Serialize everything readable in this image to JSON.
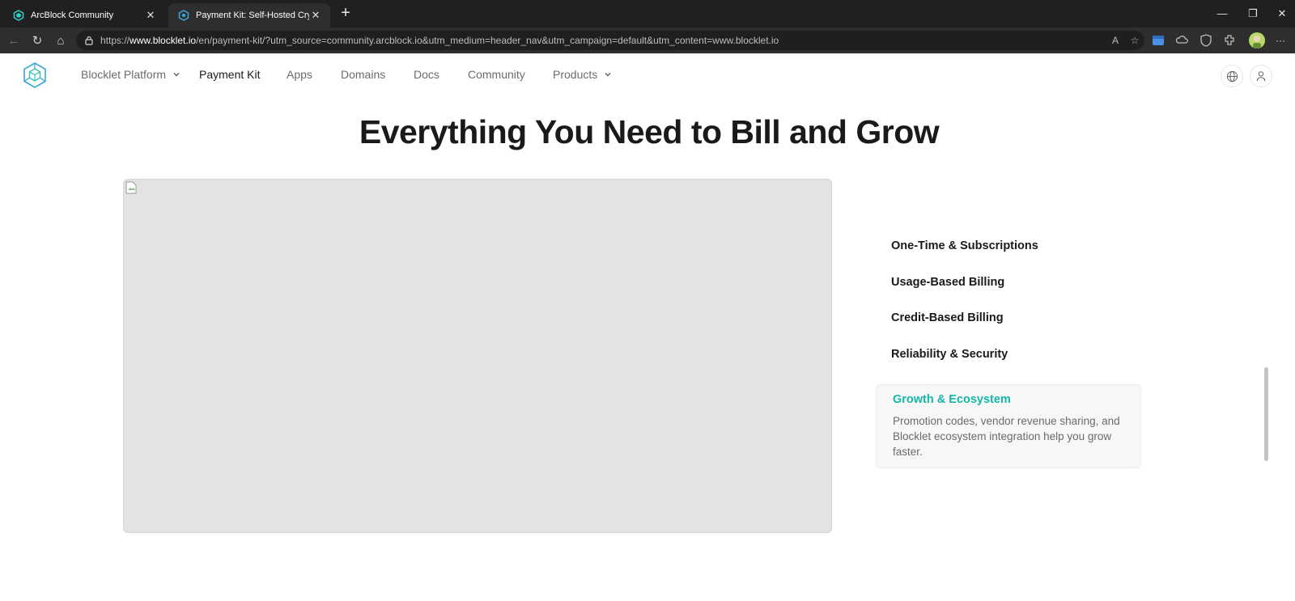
{
  "browser": {
    "tabs": [
      {
        "title": "ArcBlock Community",
        "active": false
      },
      {
        "title": "Payment Kit: Self-Hosted Crypto &",
        "active": true
      }
    ],
    "url": {
      "prefix": "https://",
      "host": "www.blocklet.io",
      "path": "/en/payment-kit/?utm_source=community.arcblock.io&utm_medium=header_nav&utm_campaign=default&utm_content=www.blocklet.io"
    },
    "icons": [
      "back-icon",
      "refresh-icon",
      "home-icon",
      "lock-icon",
      "read-aloud-icon",
      "favorite-star-icon",
      "extensions-icon",
      "profile-icon",
      "more-icon"
    ]
  },
  "site": {
    "nav": {
      "items": [
        {
          "label": "Blocklet Platform",
          "has_dropdown": true,
          "active": false
        },
        {
          "label": "Payment Kit",
          "has_dropdown": false,
          "active": true
        },
        {
          "label": "Apps",
          "has_dropdown": false,
          "active": false
        },
        {
          "label": "Domains",
          "has_dropdown": false,
          "active": false
        },
        {
          "label": "Docs",
          "has_dropdown": false,
          "active": false
        },
        {
          "label": "Community",
          "has_dropdown": false,
          "active": false
        },
        {
          "label": "Products",
          "has_dropdown": true,
          "active": false
        }
      ]
    },
    "headline": "Everything You Need to Bill and Grow",
    "features": [
      {
        "title": "One-Time & Subscriptions"
      },
      {
        "title": "Usage-Based Billing"
      },
      {
        "title": "Credit-Based Billing"
      },
      {
        "title": "Reliability & Security"
      }
    ],
    "active_feature": {
      "title": "Growth & Ecosystem",
      "description": "Promotion codes, vendor revenue sharing, and Blocklet ecosystem integration help you grow faster."
    }
  },
  "colors": {
    "accent": "#14b8a6",
    "chrome_dark": "#202020",
    "image_placeholder": "#e3e3e5"
  }
}
